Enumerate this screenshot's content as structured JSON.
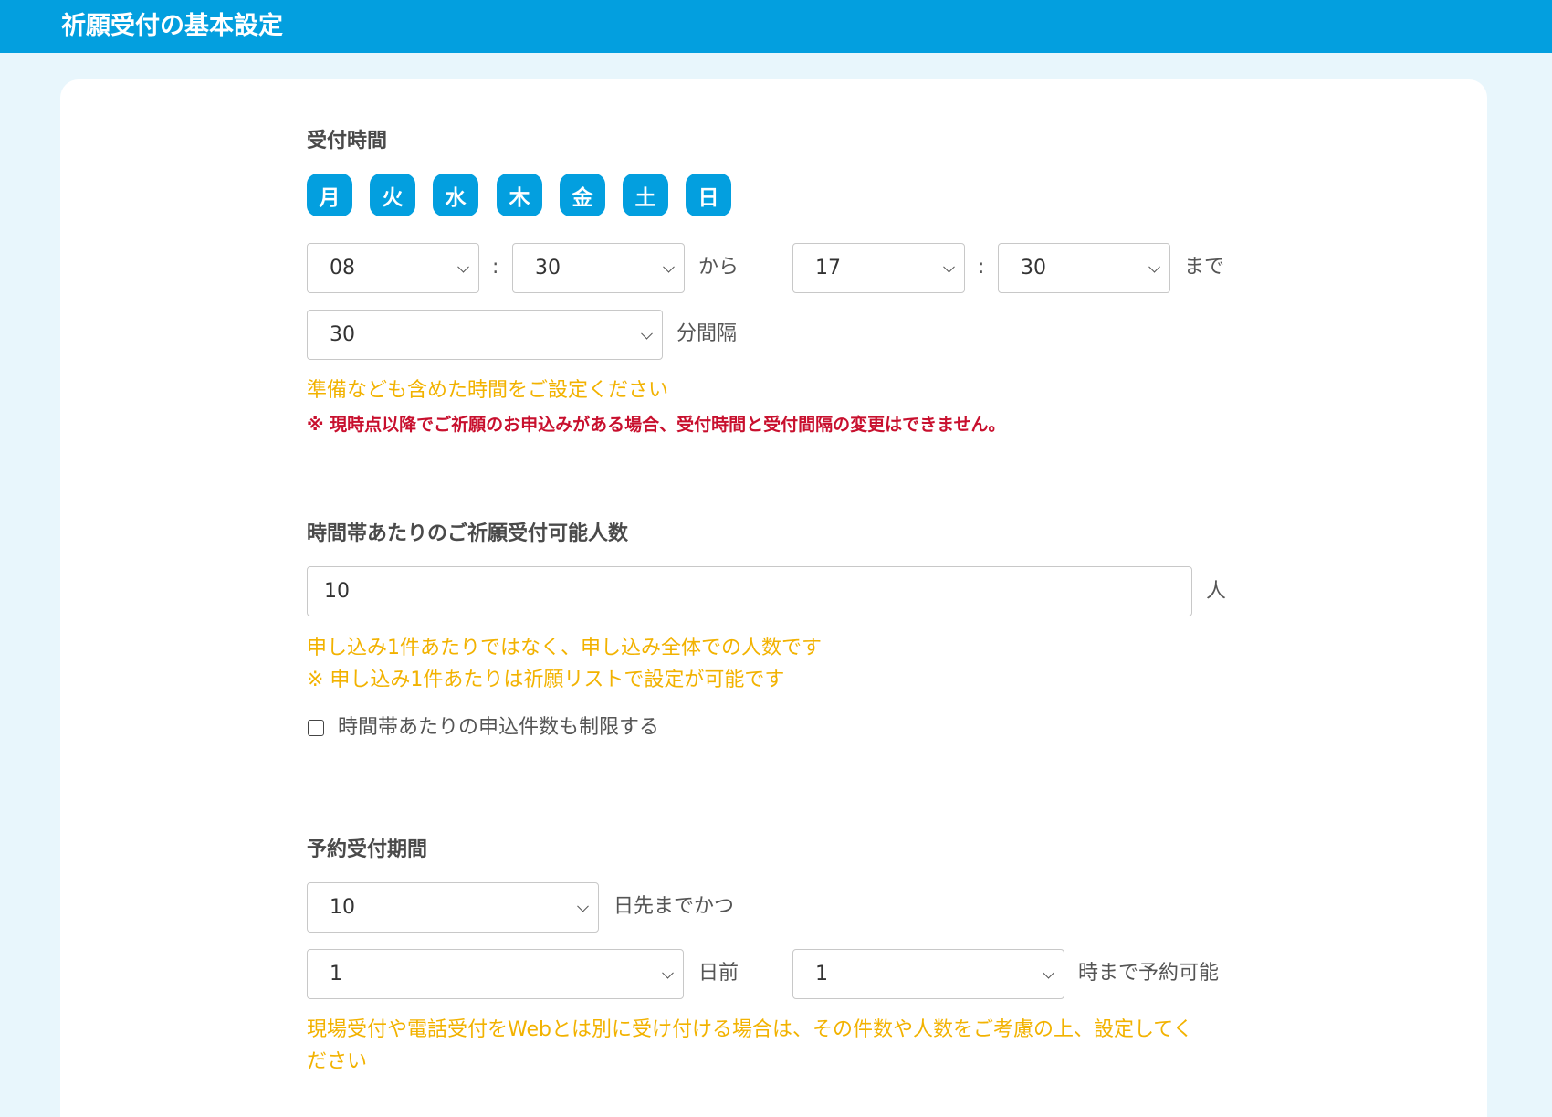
{
  "header": {
    "title": "祈願受付の基本設定"
  },
  "reception_time": {
    "title": "受付時間",
    "days": [
      "月",
      "火",
      "水",
      "木",
      "金",
      "土",
      "日"
    ],
    "start_hour": "08",
    "start_minute": "30",
    "from_label": "から",
    "end_hour": "17",
    "end_minute": "30",
    "until_label": "まで",
    "colon": ":",
    "interval": "30",
    "interval_label": "分間隔",
    "hint": "準備なども含めた時間をご設定ください",
    "warning": "※ 現時点以降でご祈願のお申込みがある場合、受付時間と受付間隔の変更はできません。"
  },
  "capacity": {
    "title": "時間帯あたりのご祈願受付可能人数",
    "value": "10",
    "unit": "人",
    "hint1": "申し込み1件あたりではなく、申し込み全体での人数です",
    "hint2": "※ 申し込み1件あたりは祈願リストで設定が可能です",
    "checkbox_label": "時間帯あたりの申込件数も制限する"
  },
  "reservation_period": {
    "title": "予約受付期間",
    "days_ahead": "10",
    "days_ahead_label": "日先までかつ",
    "days_before": "1",
    "days_before_label": "日前",
    "hour": "1",
    "hour_label": "時まで予約可能",
    "hint_line1": "現場受付や電話受付をWebとは別に受け付ける場合は、その件数や人数をご考慮の上、設定してく",
    "hint_line2": "ださい"
  }
}
